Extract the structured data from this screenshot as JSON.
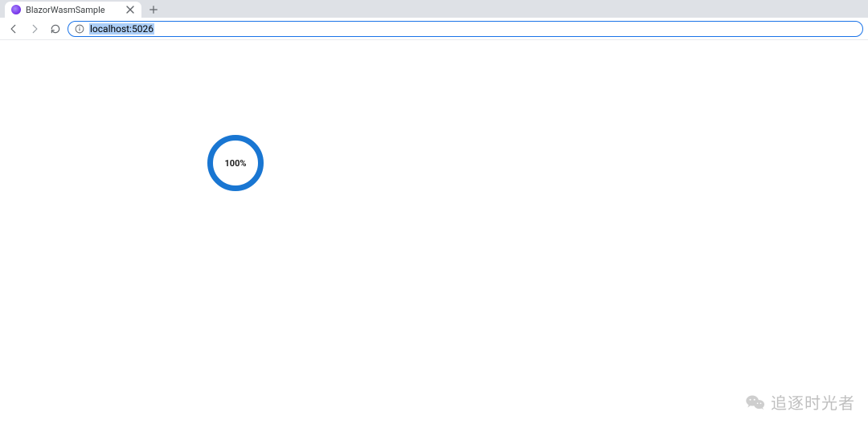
{
  "browser": {
    "tab": {
      "title": "BlazorWasmSample"
    },
    "url": "localhost:5026"
  },
  "page": {
    "loader": {
      "percent_label": "100%"
    }
  },
  "watermark": {
    "text": "追逐时光者"
  }
}
